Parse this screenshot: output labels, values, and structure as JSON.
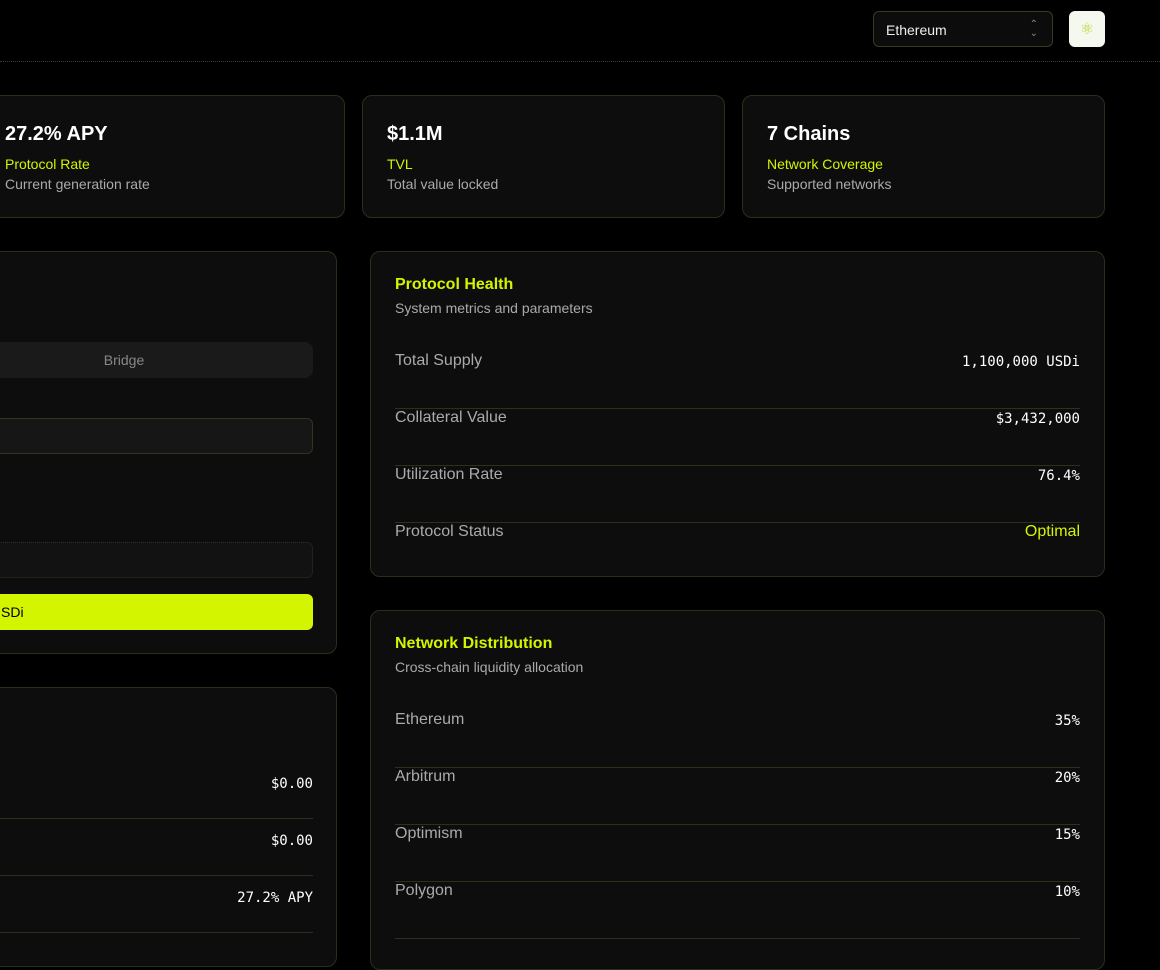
{
  "header": {
    "network_select": "Ethereum",
    "logo_icon": "atom-icon"
  },
  "stats": [
    {
      "value": "27.2% APY",
      "label": "Protocol Rate",
      "sub": "Current generation rate"
    },
    {
      "value": "$1.1M",
      "label": "TVL",
      "sub": "Total value locked"
    },
    {
      "value": "7 Chains",
      "label": "Network Coverage",
      "sub": "Supported networks"
    }
  ],
  "action_panel": {
    "tab_bridge": "Bridge",
    "submit_label": "SDi"
  },
  "position_panel": {
    "rows": [
      {
        "value": "$0.00"
      },
      {
        "value": "$0.00"
      },
      {
        "value": "27.2% APY"
      }
    ]
  },
  "health": {
    "title": "Protocol Health",
    "subtitle": "System metrics and parameters",
    "rows": [
      {
        "k": "Total Supply",
        "v": "1,100,000 USDi"
      },
      {
        "k": "Collateral Value",
        "v": "$3,432,000"
      },
      {
        "k": "Utilization Rate",
        "v": "76.4%"
      },
      {
        "k": "Protocol Status",
        "v": "Optimal"
      }
    ]
  },
  "distribution": {
    "title": "Network Distribution",
    "subtitle": "Cross-chain liquidity allocation",
    "rows": [
      {
        "k": "Ethereum",
        "v": "35%"
      },
      {
        "k": "Arbitrum",
        "v": "20%"
      },
      {
        "k": "Optimism",
        "v": "15%"
      },
      {
        "k": "Polygon",
        "v": "10%"
      }
    ]
  },
  "colors": {
    "accent": "#d4f500",
    "background": "#000000",
    "card": "#0d0d0d"
  }
}
